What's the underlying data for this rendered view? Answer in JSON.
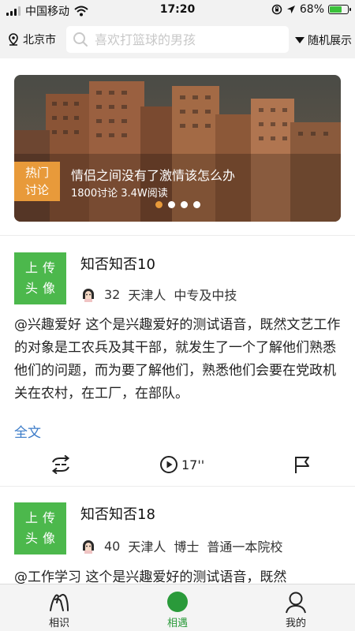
{
  "status_bar": {
    "carrier": "中国移动",
    "time": "17:20",
    "battery": "68%",
    "battery_level": 0.68
  },
  "header": {
    "city": "北京市",
    "search_placeholder": "喜欢打篮球的男孩",
    "sort_label": "随机展示"
  },
  "banner": {
    "tag_line1": "热门",
    "tag_line2": "讨论",
    "title": "情侣之间没有了激情该怎么办",
    "meta": "1800讨论 3.4W阅读",
    "dots": 4,
    "active_dot": 0
  },
  "posts": [
    {
      "avatar_line1": "上传",
      "avatar_line2": "头像",
      "name": "知否知否10",
      "age": "32",
      "hometown": "天津人",
      "education": "中专及中技",
      "school": "",
      "body": "@兴趣爱好 这个是兴趣爱好的测试语音，既然文艺工作的对象是工农兵及其干部，就发生了一个了解他们熟悉他们的问题，而为要了解他们，熟悉他们会要在党政机关在农村，在工厂，在部队。",
      "fulltext_label": "全文",
      "duration": "17''"
    },
    {
      "avatar_line1": "上传",
      "avatar_line2": "头像",
      "name": "知否知否18",
      "age": "40",
      "hometown": "天津人",
      "education": "博士",
      "school": "普通一本院校",
      "body": "@工作学习 这个是兴趣爱好的测试语音，既然",
      "fulltext_label": "",
      "duration": ""
    }
  ],
  "tabbar": {
    "items": [
      {
        "label": "相识",
        "icon": "hands-icon"
      },
      {
        "label": "相遇",
        "icon": "circle-icon"
      },
      {
        "label": "我的",
        "icon": "person-icon"
      }
    ],
    "active_index": 1,
    "accent": "#2a9a3a"
  },
  "colors": {
    "avatar_bg": "#4cb84c",
    "hot_tag": "#e89a3a",
    "link": "#3b7bc8"
  }
}
